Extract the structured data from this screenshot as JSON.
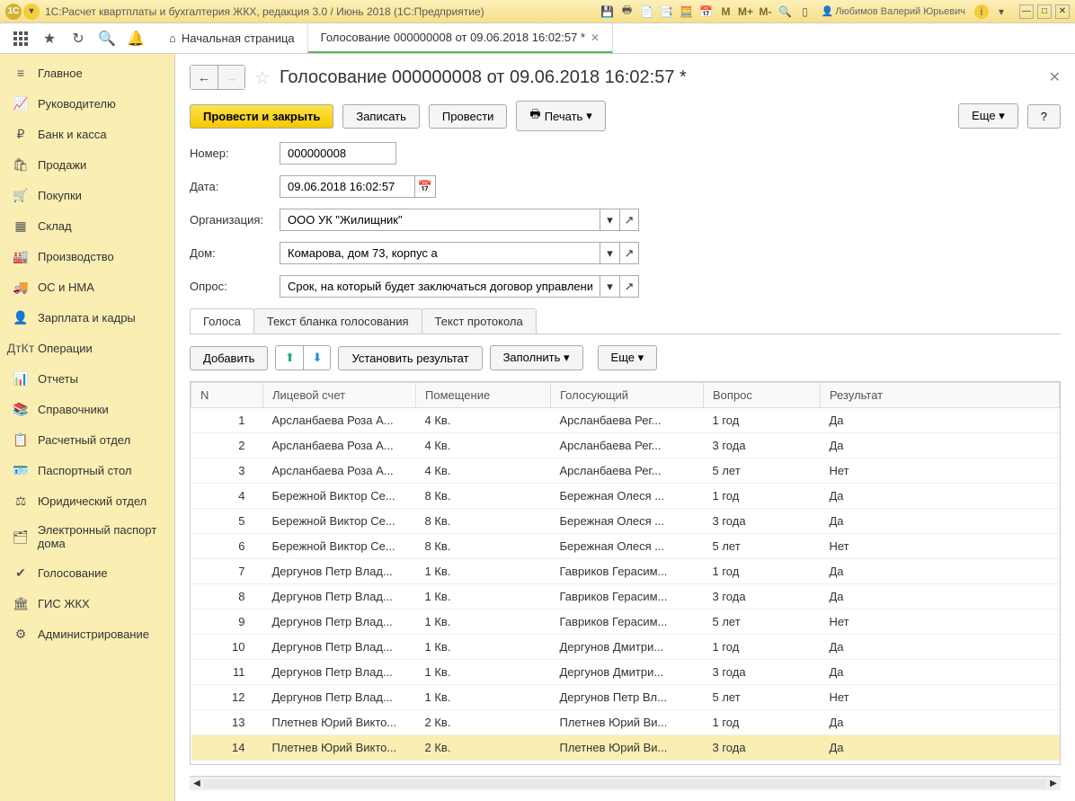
{
  "titlebar": {
    "circle1": "1С",
    "circle2": "▾",
    "title": "1С:Расчет квартплаты и бухгалтерия ЖКХ, редакция 3.0 / Июнь 2018  (1С:Предприятие)",
    "m": "M",
    "mplus": "M+",
    "mminus": "M-",
    "user": "Любимов Валерий Юрьевич",
    "info": "i"
  },
  "tabs": {
    "home": "Начальная страница",
    "active": "Голосование 000000008 от 09.06.2018 16:02:57 *"
  },
  "sidebar": [
    {
      "icon": "≡",
      "label": "Главное"
    },
    {
      "icon": "📈",
      "label": "Руководителю"
    },
    {
      "icon": "₽",
      "label": "Банк и касса"
    },
    {
      "icon": "🛍",
      "label": "Продажи"
    },
    {
      "icon": "🛒",
      "label": "Покупки"
    },
    {
      "icon": "▦",
      "label": "Склад"
    },
    {
      "icon": "🏭",
      "label": "Производство"
    },
    {
      "icon": "🚚",
      "label": "ОС и НМА"
    },
    {
      "icon": "👤",
      "label": "Зарплата и кадры"
    },
    {
      "icon": "ДтКт",
      "label": "Операции"
    },
    {
      "icon": "📊",
      "label": "Отчеты"
    },
    {
      "icon": "📚",
      "label": "Справочники"
    },
    {
      "icon": "📋",
      "label": "Расчетный отдел"
    },
    {
      "icon": "🪪",
      "label": "Паспортный стол"
    },
    {
      "icon": "⚖",
      "label": "Юридический отдел"
    },
    {
      "icon": "🗂",
      "label": "Электронный паспорт дома"
    },
    {
      "icon": "✔",
      "label": "Голосование"
    },
    {
      "icon": "🏛",
      "label": "ГИС ЖКХ"
    },
    {
      "icon": "⚙",
      "label": "Администрирование"
    }
  ],
  "page": {
    "title": "Голосование 000000008 от 09.06.2018 16:02:57 *",
    "btn_primary": "Провести и закрыть",
    "btn_save": "Записать",
    "btn_post": "Провести",
    "btn_print": "Печать",
    "btn_more": "Еще",
    "btn_help": "?",
    "lbl_number": "Номер:",
    "val_number": "000000008",
    "lbl_date": "Дата:",
    "val_date": "09.06.2018 16:02:57",
    "lbl_org": "Организация:",
    "val_org": "ООО УК \"Жилищник\"",
    "lbl_house": "Дом:",
    "val_house": "Комарова, дом 73, корпус а",
    "lbl_poll": "Опрос:",
    "val_poll": "Срок, на который будет заключаться договор управления"
  },
  "subtabs": [
    "Голоса",
    "Текст бланка голосования",
    "Текст протокола"
  ],
  "table_toolbar": {
    "add": "Добавить",
    "set": "Установить результат",
    "fill": "Заполнить",
    "more": "Еще"
  },
  "table": {
    "headers": [
      "N",
      "Лицевой счет",
      "Помещение",
      "Голосующий",
      "Вопрос",
      "Результат"
    ],
    "rows": [
      [
        "1",
        "Арсланбаева Роза А...",
        "4 Кв.",
        "Арсланбаева Рег...",
        "1 год",
        "Да"
      ],
      [
        "2",
        "Арсланбаева Роза А...",
        "4 Кв.",
        "Арсланбаева Рег...",
        "3 года",
        "Да"
      ],
      [
        "3",
        "Арсланбаева Роза А...",
        "4 Кв.",
        "Арсланбаева Рег...",
        "5 лет",
        "Нет"
      ],
      [
        "4",
        "Бережной Виктор Се...",
        "8 Кв.",
        "Бережная Олеся ...",
        "1 год",
        "Да"
      ],
      [
        "5",
        "Бережной Виктор Се...",
        "8 Кв.",
        "Бережная Олеся ...",
        "3 года",
        "Да"
      ],
      [
        "6",
        "Бережной Виктор Се...",
        "8 Кв.",
        "Бережная Олеся ...",
        "5 лет",
        "Нет"
      ],
      [
        "7",
        "Дергунов Петр Влад...",
        "1 Кв.",
        "Гавриков Герасим...",
        "1 год",
        "Да"
      ],
      [
        "8",
        "Дергунов Петр Влад...",
        "1 Кв.",
        "Гавриков Герасим...",
        "3 года",
        "Да"
      ],
      [
        "9",
        "Дергунов Петр Влад...",
        "1 Кв.",
        "Гавриков Герасим...",
        "5 лет",
        "Нет"
      ],
      [
        "10",
        "Дергунов Петр Влад...",
        "1 Кв.",
        "Дергунов Дмитри...",
        "1 год",
        "Да"
      ],
      [
        "11",
        "Дергунов Петр Влад...",
        "1 Кв.",
        "Дергунов Дмитри...",
        "3 года",
        "Да"
      ],
      [
        "12",
        "Дергунов Петр Влад...",
        "1 Кв.",
        "Дергунов Петр Вл...",
        "5 лет",
        "Нет"
      ],
      [
        "13",
        "Плетнев Юрий Викто...",
        "2 Кв.",
        "Плетнев Юрий Ви...",
        "1 год",
        "Да"
      ],
      [
        "14",
        "Плетнев Юрий Викто...",
        "2 Кв.",
        "Плетнев Юрий Ви...",
        "3 года",
        "Да"
      ]
    ],
    "selected": 13
  }
}
